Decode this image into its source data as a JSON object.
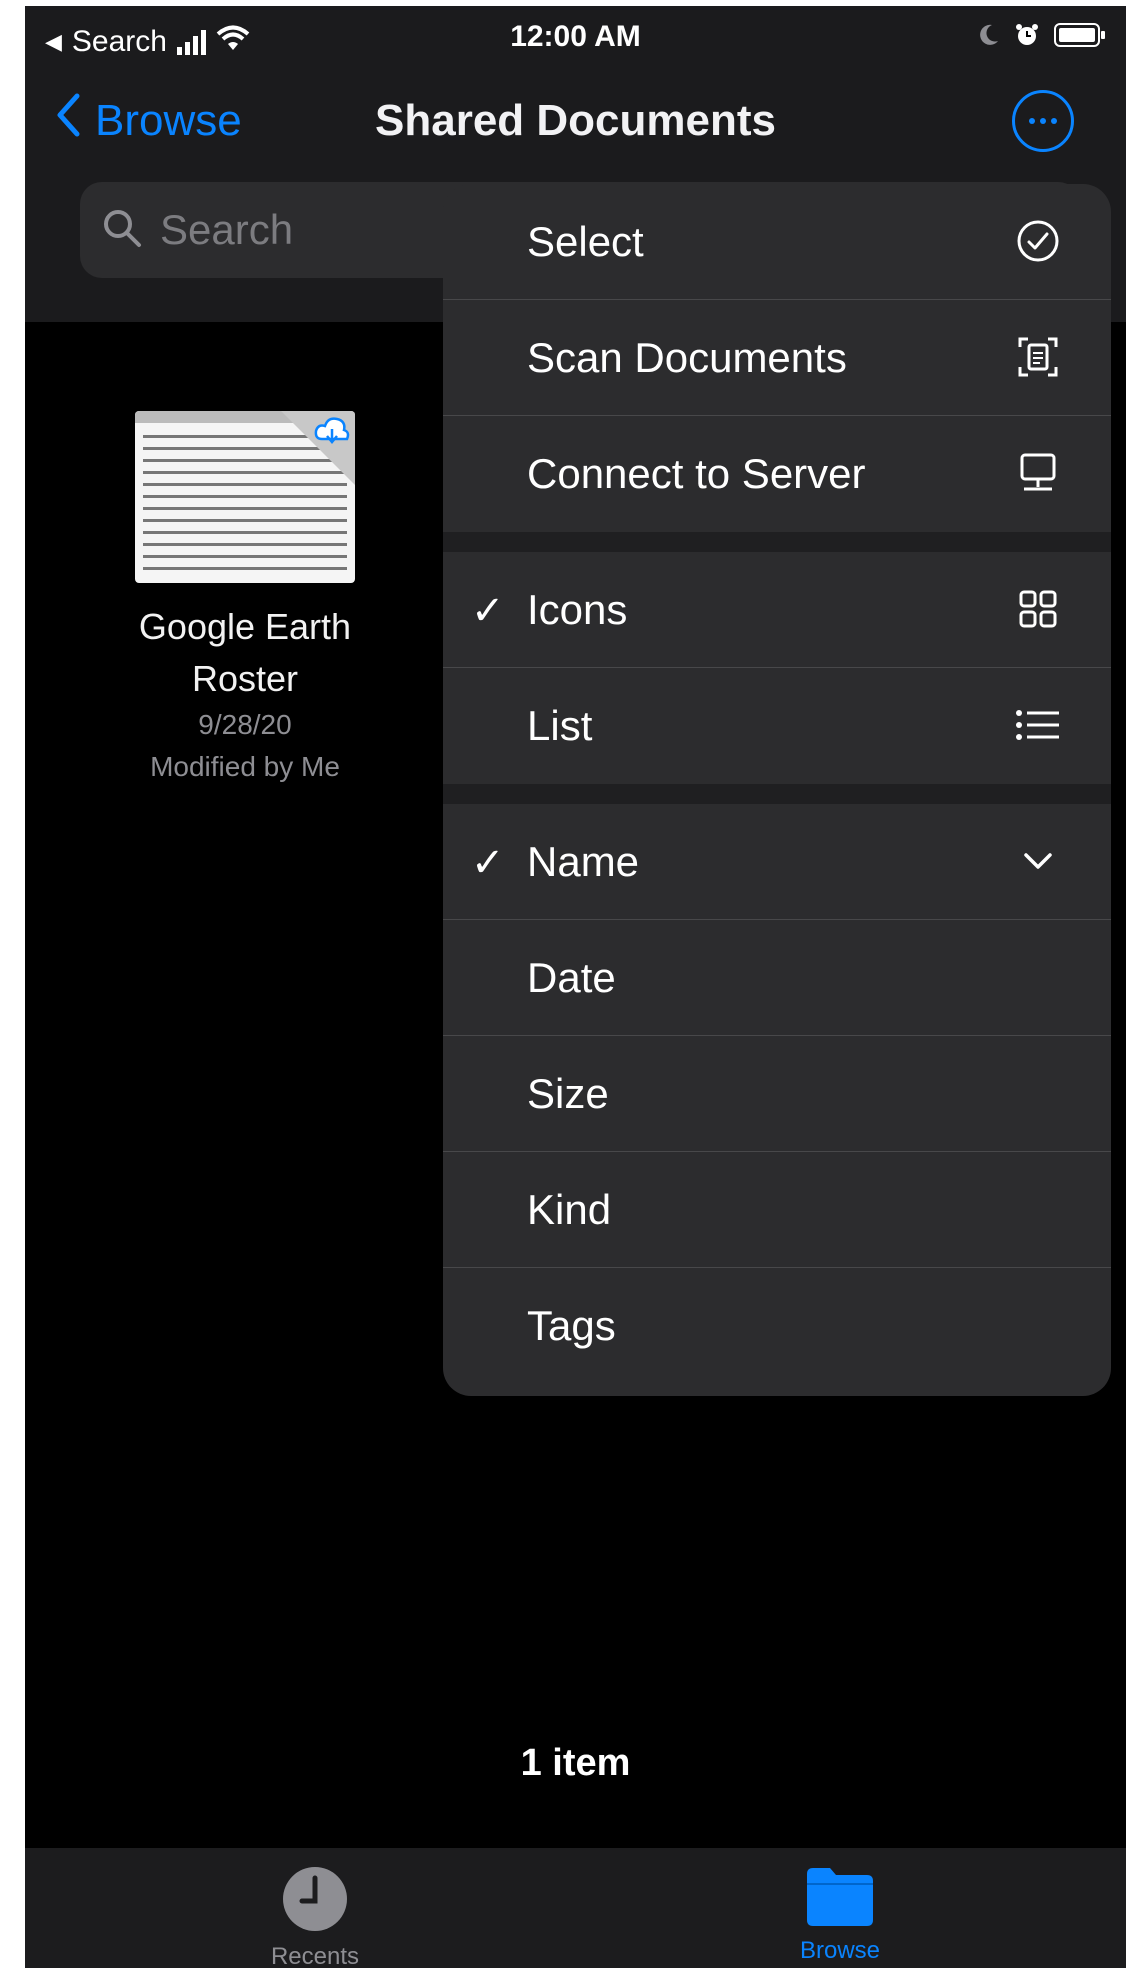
{
  "status_bar": {
    "back_app": "Search",
    "time": "12:00 AM"
  },
  "nav": {
    "back_label": "Browse",
    "title": "Shared Documents"
  },
  "search": {
    "placeholder": "Search"
  },
  "file": {
    "name_line1": "Google Earth",
    "name_line2": "Roster",
    "date": "9/28/20",
    "modified": "Modified by Me"
  },
  "menu": {
    "items": [
      {
        "label": "Select",
        "icon": "checkmark-circle-icon",
        "checked": false
      },
      {
        "label": "Scan Documents",
        "icon": "doc-viewfinder-icon",
        "checked": false
      },
      {
        "label": "Connect to Server",
        "icon": "desktop-computer-icon",
        "checked": false
      },
      {
        "label": "Icons",
        "icon": "grid-icon",
        "checked": true
      },
      {
        "label": "List",
        "icon": "list-icon",
        "checked": false
      },
      {
        "label": "Name",
        "icon": "chevron-down-icon",
        "checked": true
      },
      {
        "label": "Date",
        "icon": "",
        "checked": false
      },
      {
        "label": "Size",
        "icon": "",
        "checked": false
      },
      {
        "label": "Kind",
        "icon": "",
        "checked": false
      },
      {
        "label": "Tags",
        "icon": "",
        "checked": false
      }
    ],
    "check_glyph": "✓"
  },
  "footer": {
    "item_count": "1 item"
  },
  "tabbar": {
    "tabs": [
      {
        "label": "Recents",
        "icon": "clock-icon",
        "active": false
      },
      {
        "label": "Browse",
        "icon": "folder-icon",
        "active": true
      }
    ]
  },
  "colors": {
    "accent": "#0a84ff",
    "background": "#000000",
    "menu_bg": "#2c2c2e",
    "inactive_tab": "#8e8e93"
  }
}
